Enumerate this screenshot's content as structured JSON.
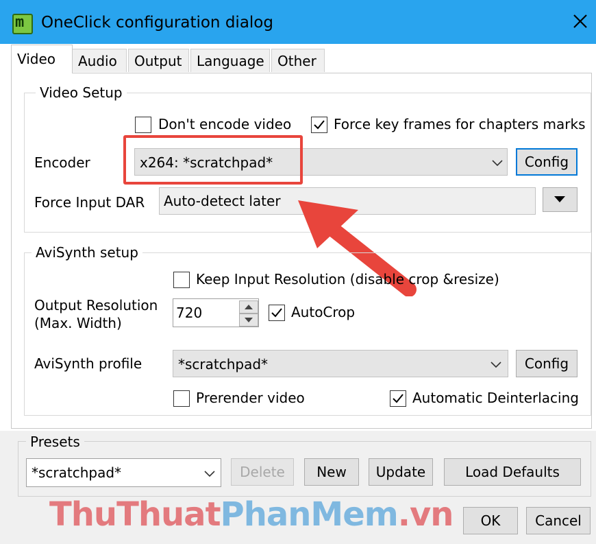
{
  "window": {
    "title": "OneClick configuration dialog",
    "icon": "app-icon",
    "close_icon": "close-icon"
  },
  "tabs": [
    "Video",
    "Audio",
    "Output",
    "Language",
    "Other"
  ],
  "video_setup": {
    "group_label": "Video Setup",
    "dont_encode_label": "Don't encode video",
    "dont_encode_checked": false,
    "force_keyframes_label": "Force key frames for chapters marks",
    "force_keyframes_checked": true,
    "encoder_label": "Encoder",
    "encoder_value": "x264: *scratchpad*",
    "encoder_config_label": "Config",
    "dar_label": "Force Input DAR",
    "dar_value": "Auto-detect later"
  },
  "avisynth": {
    "group_label": "AviSynth setup",
    "keep_res_label": "Keep Input Resolution (disable crop &resize)",
    "keep_res_checked": false,
    "output_res_label_1": "Output Resolution",
    "output_res_label_2": "(Max. Width)",
    "output_res_value": "720",
    "autocrop_label": "AutoCrop",
    "autocrop_checked": true,
    "profile_label": "AviSynth profile",
    "profile_value": "*scratchpad*",
    "profile_config_label": "Config",
    "prerender_label": "Prerender video",
    "prerender_checked": false,
    "deinterlace_label": "Automatic Deinterlacing",
    "deinterlace_checked": true
  },
  "presets": {
    "group_label": "Presets",
    "value": "*scratchpad*",
    "delete_label": "Delete",
    "new_label": "New",
    "update_label": "Update",
    "load_defaults_label": "Load Defaults"
  },
  "footer": {
    "ok_label": "OK",
    "cancel_label": "Cancel"
  },
  "watermark": {
    "part1": "ThuThuat",
    "part2": "PhanMem",
    "part3": ".vn"
  },
  "colors": {
    "titlebar": "#29a4ee",
    "highlight": "#e8453c",
    "focus": "#0078d7"
  }
}
